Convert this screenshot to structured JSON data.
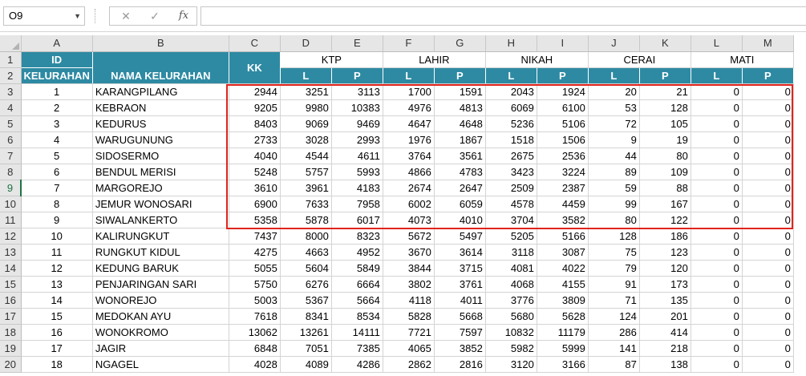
{
  "formula_bar": {
    "name_box": "O9",
    "cancel_icon": "✕",
    "enter_icon": "✓",
    "fx_label": "fx",
    "formula": ""
  },
  "columns": [
    "A",
    "B",
    "C",
    "D",
    "E",
    "F",
    "G",
    "H",
    "I",
    "J",
    "K",
    "L",
    "M"
  ],
  "header": {
    "id_top": "ID",
    "id_bottom": "KELURAHAN",
    "nama": "NAMA KELURAHAN",
    "kk": "KK",
    "groups": [
      "KTP",
      "LAHIR",
      "NIKAH",
      "CERAI",
      "MATI"
    ],
    "sub_l": "L",
    "sub_p": "P"
  },
  "row_numbers": [
    "1",
    "2",
    "3",
    "4",
    "5",
    "6",
    "7",
    "8",
    "9",
    "10",
    "11",
    "12",
    "13",
    "14",
    "15",
    "16",
    "17",
    "18",
    "19",
    "20"
  ],
  "rows": [
    [
      "1",
      "KARANGPILANG",
      "2944",
      "3251",
      "3113",
      "1700",
      "1591",
      "2043",
      "1924",
      "20",
      "21",
      "0",
      "0"
    ],
    [
      "2",
      "KEBRAON",
      "9205",
      "9980",
      "10383",
      "4976",
      "4813",
      "6069",
      "6100",
      "53",
      "128",
      "0",
      "0"
    ],
    [
      "3",
      "KEDURUS",
      "8403",
      "9069",
      "9469",
      "4647",
      "4648",
      "5236",
      "5106",
      "72",
      "105",
      "0",
      "0"
    ],
    [
      "4",
      "WARUGUNUNG",
      "2733",
      "3028",
      "2993",
      "1976",
      "1867",
      "1518",
      "1506",
      "9",
      "19",
      "0",
      "0"
    ],
    [
      "5",
      "SIDOSERMO",
      "4040",
      "4544",
      "4611",
      "3764",
      "3561",
      "2675",
      "2536",
      "44",
      "80",
      "0",
      "0"
    ],
    [
      "6",
      "BENDUL MERISI",
      "5248",
      "5757",
      "5993",
      "4866",
      "4783",
      "3423",
      "3224",
      "89",
      "109",
      "0",
      "0"
    ],
    [
      "7",
      "MARGOREJO",
      "3610",
      "3961",
      "4183",
      "2674",
      "2647",
      "2509",
      "2387",
      "59",
      "88",
      "0",
      "0"
    ],
    [
      "8",
      "JEMUR WONOSARI",
      "6900",
      "7633",
      "7958",
      "6002",
      "6059",
      "4578",
      "4459",
      "99",
      "167",
      "0",
      "0"
    ],
    [
      "9",
      "SIWALANKERTO",
      "5358",
      "5878",
      "6017",
      "4073",
      "4010",
      "3704",
      "3582",
      "80",
      "122",
      "0",
      "0"
    ],
    [
      "10",
      "KALIRUNGKUT",
      "7437",
      "8000",
      "8323",
      "5672",
      "5497",
      "5205",
      "5166",
      "128",
      "186",
      "0",
      "0"
    ],
    [
      "11",
      "RUNGKUT KIDUL",
      "4275",
      "4663",
      "4952",
      "3670",
      "3614",
      "3118",
      "3087",
      "75",
      "123",
      "0",
      "0"
    ],
    [
      "12",
      "KEDUNG BARUK",
      "5055",
      "5604",
      "5849",
      "3844",
      "3715",
      "4081",
      "4022",
      "79",
      "120",
      "0",
      "0"
    ],
    [
      "13",
      "PENJARINGAN SARI",
      "5750",
      "6276",
      "6664",
      "3802",
      "3761",
      "4068",
      "4155",
      "91",
      "173",
      "0",
      "0"
    ],
    [
      "14",
      "WONOREJO",
      "5003",
      "5367",
      "5664",
      "4118",
      "4011",
      "3776",
      "3809",
      "71",
      "135",
      "0",
      "0"
    ],
    [
      "15",
      "MEDOKAN AYU",
      "7618",
      "8341",
      "8534",
      "5828",
      "5668",
      "5680",
      "5628",
      "124",
      "201",
      "0",
      "0"
    ],
    [
      "16",
      "WONOKROMO",
      "13062",
      "13261",
      "14111",
      "7721",
      "7597",
      "10832",
      "11179",
      "286",
      "414",
      "0",
      "0"
    ],
    [
      "17",
      "JAGIR",
      "6848",
      "7051",
      "7385",
      "4065",
      "3852",
      "5982",
      "5999",
      "141",
      "218",
      "0",
      "0"
    ],
    [
      "18",
      "NGAGEL",
      "4028",
      "4089",
      "4286",
      "2862",
      "2816",
      "3120",
      "3166",
      "87",
      "138",
      "0",
      "0"
    ]
  ]
}
